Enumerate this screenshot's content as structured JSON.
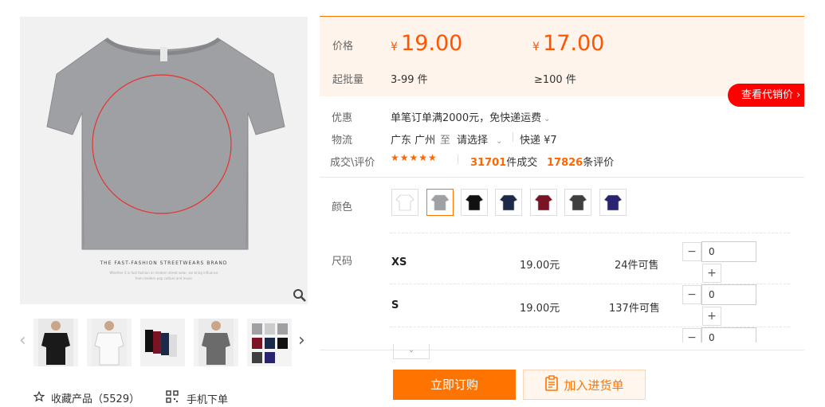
{
  "gallery": {
    "brand_line": "THE FAST-FASHION STREETWEARS BRAND",
    "brand_sub": "Whether it is fast fashion or modern street wear, we bring influence",
    "brand_sub2": "from modern pop culture and music",
    "favorite_label": "收藏产品（5529）",
    "mobile_label": "手机下单",
    "thumb_prev": "‹",
    "thumb_next": "›"
  },
  "pricing": {
    "price_label": "价格",
    "moq_label": "起批量",
    "currency": "¥",
    "tiers": [
      {
        "price": "19.00",
        "range": "3-99 件"
      },
      {
        "price": "17.00",
        "range": "≥100 件"
      }
    ],
    "daixiao_label": "查看代销价 ›"
  },
  "info": {
    "promo_label": "优惠",
    "promo_text": "单笔订单满2000元，免快递运费",
    "logistics_label": "物流",
    "origin": "广东 广州",
    "to": "至",
    "destination": "请选择",
    "shipping": "快递 ¥7",
    "deal_label": "成交\\评价",
    "stars": "★★★★★",
    "deals_count": "31701",
    "deals_suffix": "件成交",
    "reviews_count": "17826",
    "reviews_suffix": "条评价"
  },
  "colors": {
    "label": "颜色",
    "swatches": [
      "#ffffff",
      "#9ea0a3",
      "#111111",
      "#1c2a4a",
      "#7a1424",
      "#3f3f3f",
      "#2a2470"
    ],
    "selected_index": 1
  },
  "sizes": {
    "label": "尺码",
    "rows": [
      {
        "name": "XS",
        "price": "19.00元",
        "stock": "24件可售",
        "qty": "0"
      },
      {
        "name": "S",
        "price": "19.00元",
        "stock": "137件可售",
        "qty": "0"
      },
      {
        "name": "",
        "price": "",
        "stock": "",
        "qty": "0"
      }
    ],
    "minus": "−",
    "plus": "+"
  },
  "actions": {
    "buy_label": "立即订购",
    "cart_label": "加入进货单"
  },
  "theme": {
    "accent": "#ff7300",
    "price": "#ff5500",
    "red": "#ff0000"
  }
}
